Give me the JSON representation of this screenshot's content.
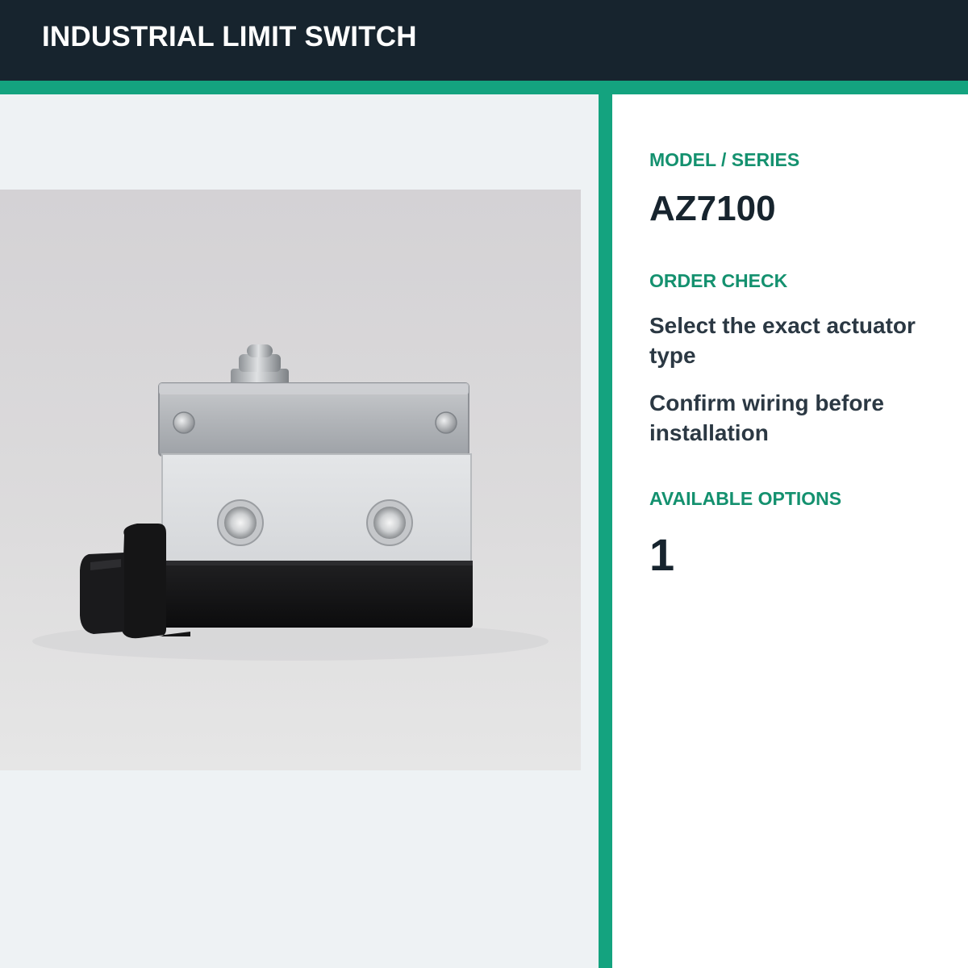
{
  "header": {
    "title": "INDUSTRIAL LIMIT SWITCH"
  },
  "product_image": {
    "subject": "limit-switch-product-photo"
  },
  "details": {
    "model_label": "MODEL / SERIES",
    "model_value": "AZ7100",
    "order_check_label": "ORDER CHECK",
    "order_check_items": [
      "Select the exact actuator type",
      "Confirm wiring before installation"
    ],
    "options_label": "AVAILABLE OPTIONS",
    "options_value": "1"
  },
  "colors": {
    "header_bg": "#17242e",
    "accent": "#14a37f",
    "label_text": "#14916f",
    "value_text": "#17242e"
  }
}
